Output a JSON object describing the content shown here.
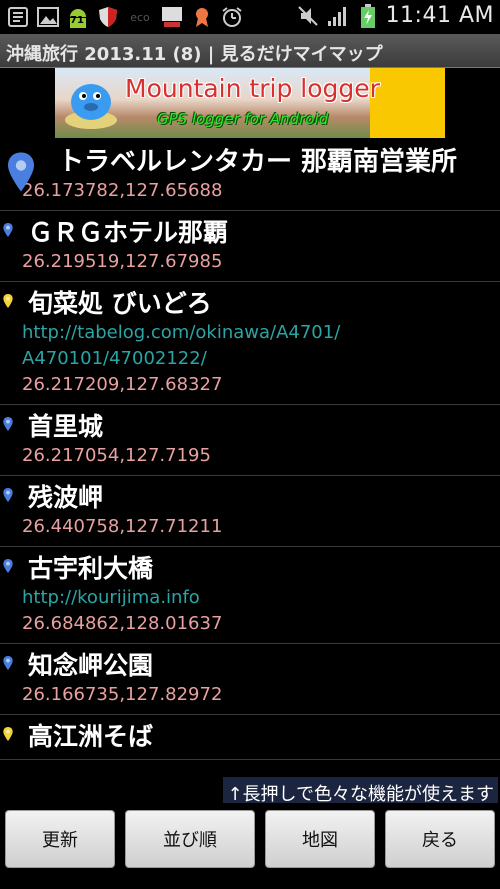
{
  "status_bar": {
    "time": "11:41 AM",
    "battery_badge": "71",
    "icons": [
      "notes-icon",
      "image-icon",
      "android-71-icon",
      "shield-icon",
      "eco-icon",
      "tv-icon",
      "ribbon-icon",
      "alarm-icon",
      "mute-icon",
      "signal-icon",
      "battery-charging-icon"
    ]
  },
  "title_bar": {
    "title": "沖縄旅行 2013.11 (8) | 見るだけマイマップ"
  },
  "banner": {
    "title": "Mountain trip logger",
    "subtitle": "GPS logger for Android"
  },
  "places": [
    {
      "name": "トラベルレンタカー 那覇南営業所",
      "url": "",
      "coord": "26.173782,127.65688",
      "pin_color": "#4a7fe0",
      "big": true
    },
    {
      "name": "ＧＲＧホテル那覇",
      "url": "",
      "coord": "26.219519,127.67985",
      "pin_color": "#4a7fe0",
      "big": false
    },
    {
      "name": "旬菜処 びいどろ",
      "url": "http://tabelog.com/okinawa/A4701/\nA470101/47002122/",
      "coord": "26.217209,127.68327",
      "pin_color": "#f3d23a",
      "big": false
    },
    {
      "name": "首里城",
      "url": "",
      "coord": "26.217054,127.7195",
      "pin_color": "#4a7fe0",
      "big": false
    },
    {
      "name": "残波岬",
      "url": "",
      "coord": "26.440758,127.71211",
      "pin_color": "#4a7fe0",
      "big": false
    },
    {
      "name": "古宇利大橋",
      "url": "http://kourijima.info",
      "coord": "26.684862,128.01637",
      "pin_color": "#4a7fe0",
      "big": false
    },
    {
      "name": "知念岬公園",
      "url": "",
      "coord": "26.166735,127.82972",
      "pin_color": "#4a7fe0",
      "big": false
    },
    {
      "name": "高江洲そば",
      "url": "",
      "coord": "",
      "pin_color": "#f3d23a",
      "big": false
    }
  ],
  "hint": "↑長押しで色々な機能が使えます",
  "buttons": {
    "refresh": "更新",
    "sort": "並び順",
    "map": "地図",
    "back": "戻る"
  }
}
